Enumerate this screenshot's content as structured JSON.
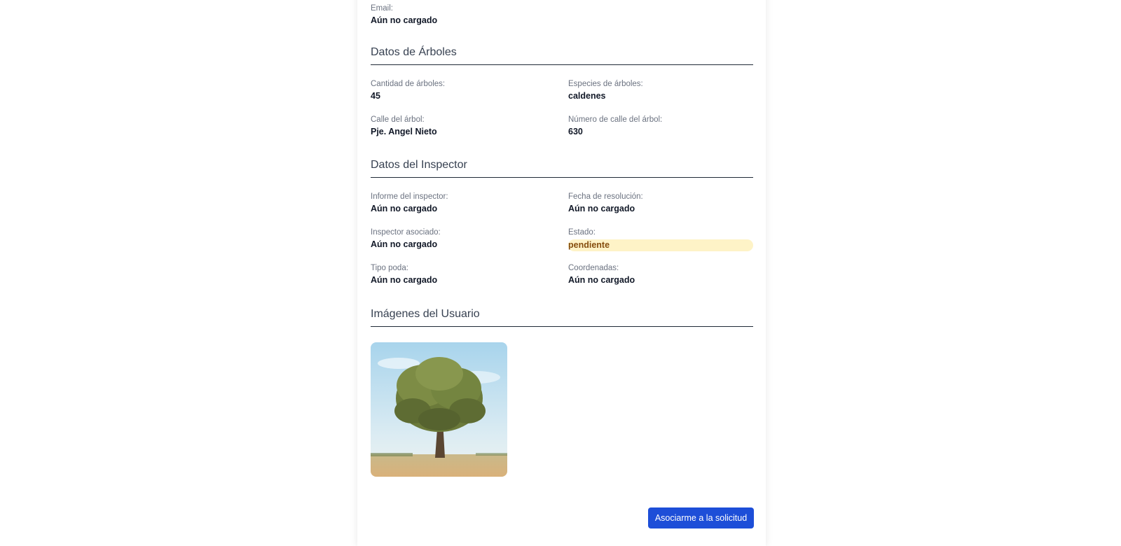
{
  "email": {
    "label": "Email:",
    "value": "Aún no cargado"
  },
  "arboles": {
    "title": "Datos de Árboles",
    "cantidad": {
      "label": "Cantidad de árboles:",
      "value": "45"
    },
    "especies": {
      "label": "Especies de árboles:",
      "value": "caldenes"
    },
    "calle": {
      "label": "Calle del árbol:",
      "value": "Pje. Angel Nieto"
    },
    "numero": {
      "label": "Número de calle del árbol:",
      "value": "630"
    }
  },
  "inspector": {
    "title": "Datos del Inspector",
    "informe": {
      "label": "Informe del inspector:",
      "value": "Aún no cargado"
    },
    "fecha": {
      "label": "Fecha de resolución:",
      "value": "Aún no cargado"
    },
    "asociado": {
      "label": "Inspector asociado:",
      "value": "Aún no cargado"
    },
    "estado": {
      "label": "Estado:",
      "value": "pendiente",
      "badge_color": "#fef3c7",
      "text_color": "#854d0e"
    },
    "tipo_poda": {
      "label": "Tipo poda:",
      "value": "Aún no cargado"
    },
    "coordenadas": {
      "label": "Coordenadas:",
      "value": "Aún no cargado"
    }
  },
  "imagenes": {
    "title": "Imágenes del Usuario",
    "photo_icon": "tree-photo"
  },
  "actions": {
    "associate_label": "Asociarme a la solicitud",
    "accent": "#1d4ed8"
  }
}
